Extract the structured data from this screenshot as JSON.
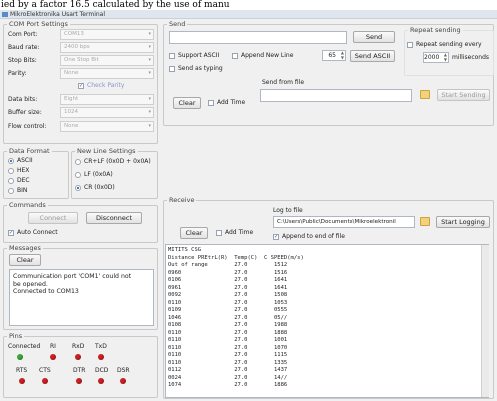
{
  "caption": "ied by a factor 16.5 calculated by the use of manu",
  "window": {
    "title": "MikroElektronika Usart Terminal"
  },
  "com_settings": {
    "legend": "COM Port Settings",
    "fields": [
      {
        "label": "Com Port:",
        "value": "COM13"
      },
      {
        "label": "Baud rate:",
        "value": "2400 bps"
      },
      {
        "label": "Stop Bits:",
        "value": "One Stop Bit"
      },
      {
        "label": "Parity:",
        "value": "None"
      },
      {
        "label": "Data bits:",
        "value": "Eight"
      },
      {
        "label": "Buffer size:",
        "value": "1024"
      },
      {
        "label": "Flow control:",
        "value": "None"
      }
    ],
    "check_parity": "Check Parity"
  },
  "data_format": {
    "legend": "Data Format",
    "options": [
      "ASCII",
      "HEX",
      "DEC",
      "BIN"
    ],
    "selected": "ASCII"
  },
  "new_line": {
    "legend": "New Line Settings",
    "options": [
      "CR+LF (0x0D + 0x0A)",
      "LF (0x0A)",
      "CR (0x0D)"
    ],
    "selected": "CR (0x0D)"
  },
  "commands": {
    "legend": "Commands",
    "connect": "Connect",
    "disconnect": "Disconnect",
    "auto_connect": "Auto Connect"
  },
  "messages": {
    "legend": "Messages",
    "clear": "Clear",
    "text": [
      "Communication port 'COM1' could not",
      "be opened.",
      "Connected to COM13"
    ]
  },
  "pins": {
    "legend": "Pins",
    "top": [
      {
        "label": "Connected",
        "color": "#3aa63a"
      },
      {
        "label": "RI",
        "color": "#cc1f1f"
      },
      {
        "label": "RxD",
        "color": "#cc1f1f"
      },
      {
        "label": "TxD",
        "color": "#cc1f1f"
      }
    ],
    "bottom": [
      {
        "label": "RTS",
        "color": "#cc1f1f"
      },
      {
        "label": "CTS",
        "color": "#cc1f1f"
      },
      {
        "label": "DTR",
        "color": "#cc1f1f"
      },
      {
        "label": "DCD",
        "color": "#cc1f1f"
      },
      {
        "label": "DSR",
        "color": "#cc1f1f"
      }
    ]
  },
  "send": {
    "legend": "Send",
    "send_button": "Send",
    "support_ascii": "Support ASCII",
    "append_new_line": "Append New Line",
    "ascii_value": "65",
    "send_ascii": "Send ASCII",
    "send_as_typing": "Send as typing",
    "clear": "Clear",
    "add_time": "Add Time",
    "send_from_file": "Send from file",
    "start_sending": "Start Sending"
  },
  "repeat": {
    "legend": "Repeat sending",
    "label": "Repeat sending every",
    "ms_value": "2000",
    "ms_unit": "milliseconds"
  },
  "receive": {
    "legend": "Receive",
    "clear": "Clear",
    "add_time": "Add Time",
    "log_to_file": "Log to file",
    "log_path": "C:\\Users\\Public\\Documents\\Mikroelektronil",
    "start_logging": "Start Logging",
    "append_end": "Append to end of file",
    "lines": [
      "MITITS CSG",
      "Distance PREtrL(R)  Temp(C)  C SPEED(m/s)",
      "Out of range        27.0        1512",
      "0960                27.0        1516",
      "0106                27.0        1641",
      "0961                27.0        1641",
      "0092                27.0        1508",
      "0110                27.0        1053",
      "0109                27.0        0555",
      "1046                27.0        05//",
      "0108                27.0        1988",
      "0110                27.0        1888",
      "0110                27.0        1001",
      "0110                27.0        1070",
      "0110                27.0        1115",
      "0110                27.0        1335",
      "0112                27.0        1437",
      "0024                27.0        14//",
      "1074                27.0        1886"
    ]
  }
}
